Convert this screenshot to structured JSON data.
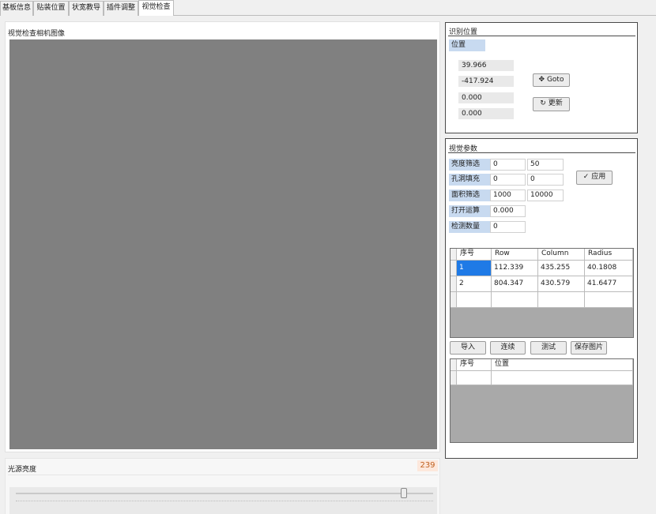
{
  "tabs": [
    {
      "label": "基板信息"
    },
    {
      "label": "贴装位置"
    },
    {
      "label": "状宽教导"
    },
    {
      "label": "插件调整"
    },
    {
      "label": "视觉检查"
    }
  ],
  "camera": {
    "title": "视觉检查相机图像"
  },
  "brightness": {
    "title": "光源亮度",
    "value": "239",
    "slider_value": 239,
    "slider_max": 255
  },
  "recognition": {
    "title": "识别位置",
    "position_label": "位置",
    "values": [
      "39.966",
      "-417.924",
      "0.000",
      "0.000"
    ],
    "goto_label": "Goto",
    "update_label": "更新"
  },
  "vision": {
    "title": "视觉参数",
    "params": [
      {
        "label": "亮度筛选",
        "v1": "0",
        "v2": "50"
      },
      {
        "label": "孔洞填充",
        "v1": "0",
        "v2": "0"
      },
      {
        "label": "面积筛选",
        "v1": "1000",
        "v2": "10000"
      },
      {
        "label": "打开运算",
        "v1": "0.000"
      },
      {
        "label": "检测数量",
        "v1": "0"
      }
    ],
    "apply_label": "应用"
  },
  "results_table": {
    "headers": [
      "序号",
      "Row",
      "Column",
      "Radius"
    ],
    "rows": [
      [
        "1",
        "112.339",
        "435.255",
        "40.1808"
      ],
      [
        "2",
        "804.347",
        "430.579",
        "41.6477"
      ]
    ]
  },
  "buttons": {
    "import": "导入",
    "continue": "连续",
    "test": "测试",
    "save": "保存图片"
  },
  "position_table": {
    "headers": [
      "序号",
      "位置"
    ]
  },
  "icons": {
    "goto": "move-icon",
    "update": "refresh-icon",
    "apply": "check-icon"
  }
}
